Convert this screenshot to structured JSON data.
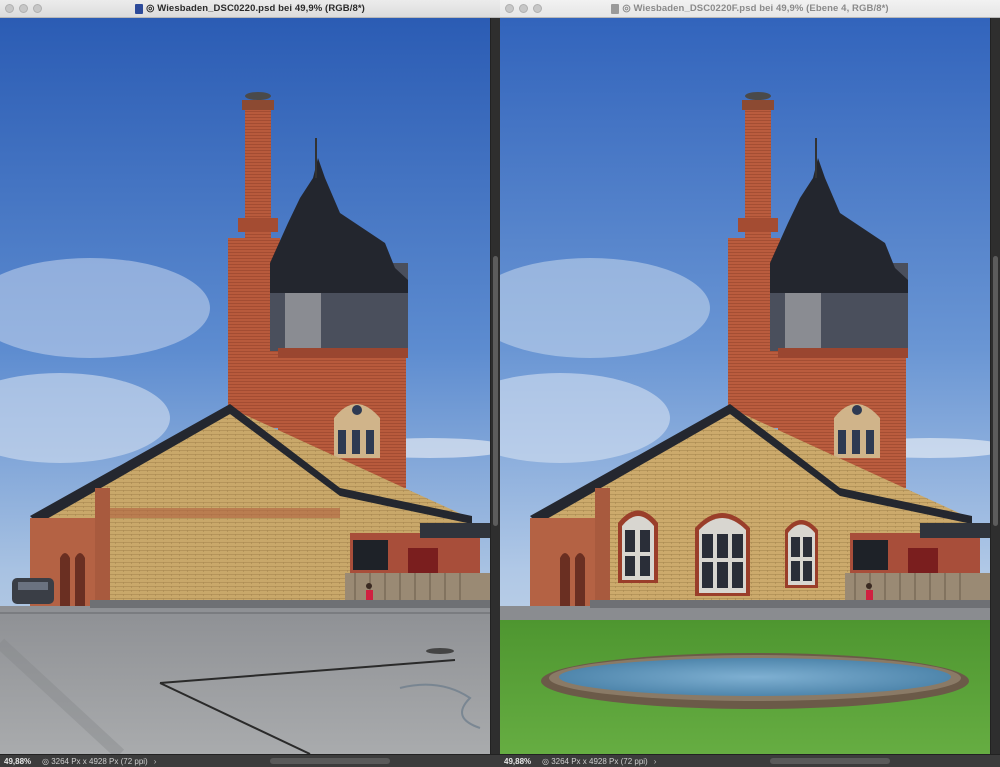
{
  "windows": [
    {
      "title": "◎ Wiesbaden_DSC0220.psd bei 49,9% (RGB/8*)",
      "zoom": "49,88%",
      "document_info": "◎ 3264 Px x 4928 Px (72 ppi)",
      "status_chevron": "›"
    },
    {
      "title": "◎ Wiesbaden_DSC0220F.psd bei 49,9% (Ebene 4, RGB/8*)",
      "zoom": "49,88%",
      "document_info": "◎ 3264 Px x 4928 Px (72 ppi)",
      "status_chevron": "›"
    }
  ],
  "colors": {
    "sky_top": "#2a5bb3",
    "sky_bottom": "#b9cde4",
    "brick": "#b5563a",
    "yellow_brick": "#c9a86a",
    "roof": "#2b2e36",
    "slate": "#4a4f5c",
    "pavement": "#9c9ea0",
    "grass": "#5aa03a",
    "pond": "#5f93b8",
    "statusbar": "#3c3c3c"
  }
}
